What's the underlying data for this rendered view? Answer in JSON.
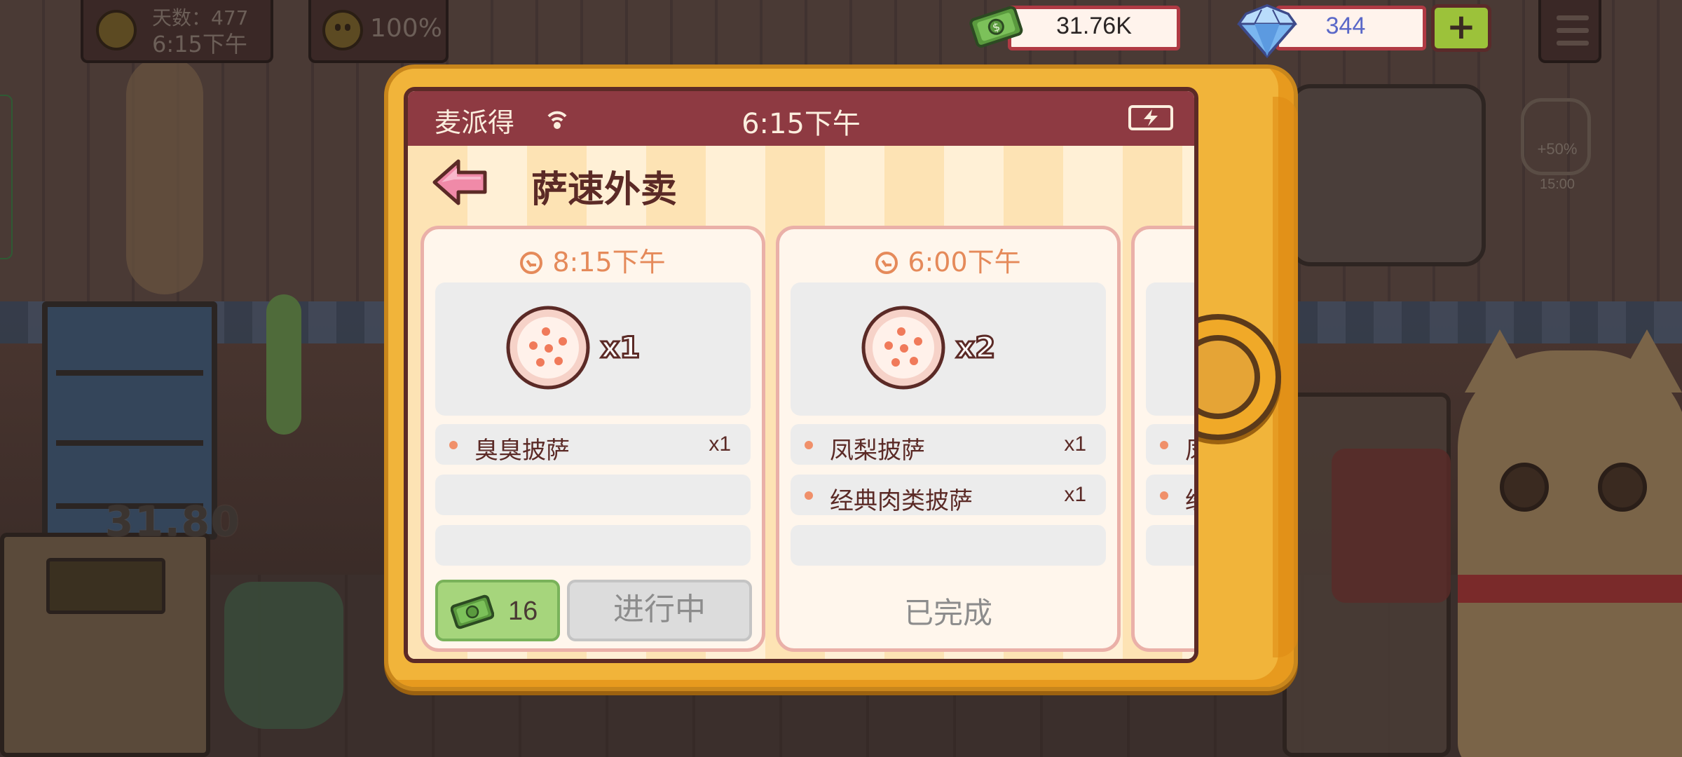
{
  "hud": {
    "day_label": "天数：477",
    "time_label": "6:15下午",
    "mood_percent": "100%",
    "money": "31.76K",
    "gems": "344",
    "add_gems_label": "+"
  },
  "background": {
    "counter_price": "31.80",
    "jar_bonus": "+50%",
    "jar_timer": "15:00"
  },
  "phone": {
    "status_bar": {
      "carrier": "麦派得",
      "clock": "6:15下午"
    },
    "app_title": "萨速外卖",
    "orders": [
      {
        "deadline": "8:15下午",
        "pizza_count": "x1",
        "items": [
          {
            "name": "臭臭披萨",
            "qty": "x1"
          }
        ],
        "reward": "16",
        "status": "进行中"
      },
      {
        "deadline": "6:00下午",
        "pizza_count": "x2",
        "items": [
          {
            "name": "凤梨披萨",
            "qty": "x1"
          },
          {
            "name": "经典肉类披萨",
            "qty": "x1"
          }
        ],
        "status": "已完成"
      },
      {
        "items": [
          {
            "name": "凤"
          },
          {
            "name": "经"
          }
        ]
      }
    ]
  },
  "colors": {
    "phone_frame": "#f1b43a",
    "status_bar": "#8e3a42",
    "accent_time": "#e58a5a",
    "reward_green": "#a6d57c",
    "gem_text": "#5a68c8"
  }
}
